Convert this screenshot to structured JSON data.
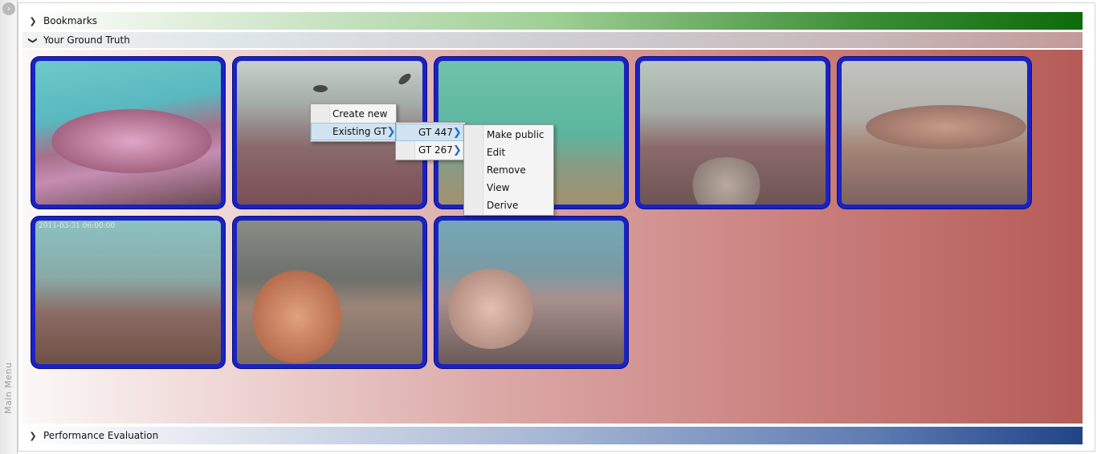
{
  "main_menu": {
    "label": "Main Menu",
    "toggle_icon": "chevron-right-icon"
  },
  "sections": {
    "bookmarks": {
      "title": "Bookmarks",
      "icon": "chevron-right-icon",
      "collapsed": true
    },
    "ground_truth": {
      "title": "Your Ground Truth",
      "icon": "chevron-down-icon",
      "collapsed": false
    },
    "performance": {
      "title": "Performance Evaluation",
      "icon": "chevron-right-icon",
      "collapsed": true
    }
  },
  "thumbnails": [
    {
      "id": 1,
      "caption": ""
    },
    {
      "id": 2,
      "caption": ""
    },
    {
      "id": 3,
      "caption": ""
    },
    {
      "id": 4,
      "caption": ""
    },
    {
      "id": 5,
      "caption": ""
    },
    {
      "id": 6,
      "caption": "2011-03-31 06:00:00"
    },
    {
      "id": 7,
      "caption": ""
    },
    {
      "id": 8,
      "caption": ""
    }
  ],
  "context_menu": {
    "items": [
      "Create new",
      "Existing GT"
    ],
    "submenu_gt": [
      "GT 447",
      "GT 267"
    ],
    "submenu_actions": [
      "Make public",
      "Edit",
      "Remove",
      "View",
      "Derive"
    ]
  },
  "colors": {
    "thumb_border": "#1a22c4",
    "menu_highlight": "#cfe3f2",
    "arrow": "#1f6fbf"
  }
}
